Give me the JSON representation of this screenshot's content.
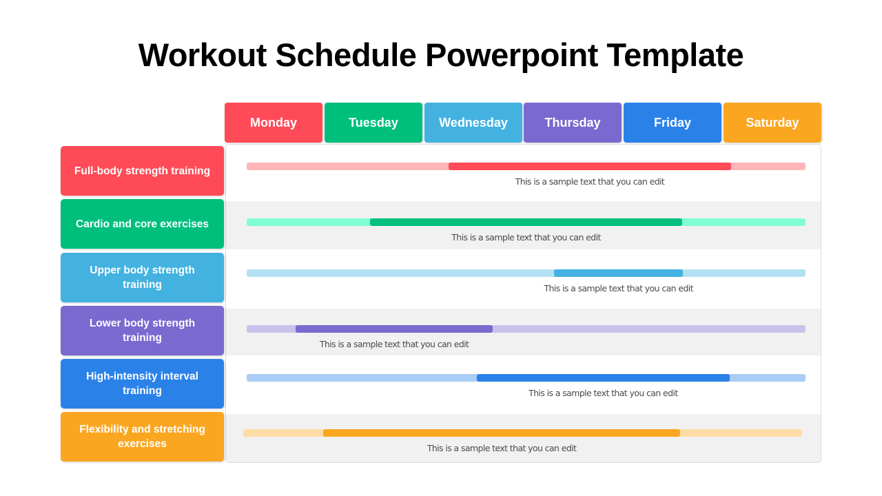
{
  "title": "Workout Schedule Powerpoint Template",
  "days": [
    {
      "label": "Monday",
      "color": "#FF4A57"
    },
    {
      "label": "Tuesday",
      "color": "#00BF7D"
    },
    {
      "label": "Wednesday",
      "color": "#43B2E0"
    },
    {
      "label": "Thursday",
      "color": "#7A69CF"
    },
    {
      "label": "Friday",
      "color": "#2A82E9"
    },
    {
      "label": "Saturday",
      "color": "#FAA621"
    }
  ],
  "rows": [
    {
      "label": "Full-body strength training",
      "color": "#FF4A57",
      "track_color": "#FFB5B9",
      "start": 0.361,
      "end": 0.867,
      "caption": "This is a sample text that you can edit"
    },
    {
      "label": "Cardio and core exercises",
      "color": "#00BF7D",
      "track_color": "#82FDD2",
      "start": 0.221,
      "end": 0.779,
      "caption": "This is a sample text that you can edit"
    },
    {
      "label": "Upper body strength training",
      "color": "#43B2E0",
      "track_color": "#B3E0F3",
      "start": 0.55,
      "end": 0.781,
      "caption": "This is a sample text that you can edit"
    },
    {
      "label": "Lower body strength training",
      "color": "#7A69CF",
      "track_color": "#C9C2EB",
      "start": 0.088,
      "end": 0.44,
      "caption": "This is a sample text that you can edit"
    },
    {
      "label": "High-intensity interval training",
      "color": "#2A82E9",
      "track_color": "#AACDF5",
      "start": 0.412,
      "end": 0.864,
      "caption": "This is a sample text that you can edit"
    },
    {
      "label": "Flexibility and stretching exercises",
      "color": "#FAA621",
      "track_color": "#FDDCA6",
      "start": 0.143,
      "end": 0.782,
      "caption": "This is a sample text that you can edit"
    }
  ]
}
